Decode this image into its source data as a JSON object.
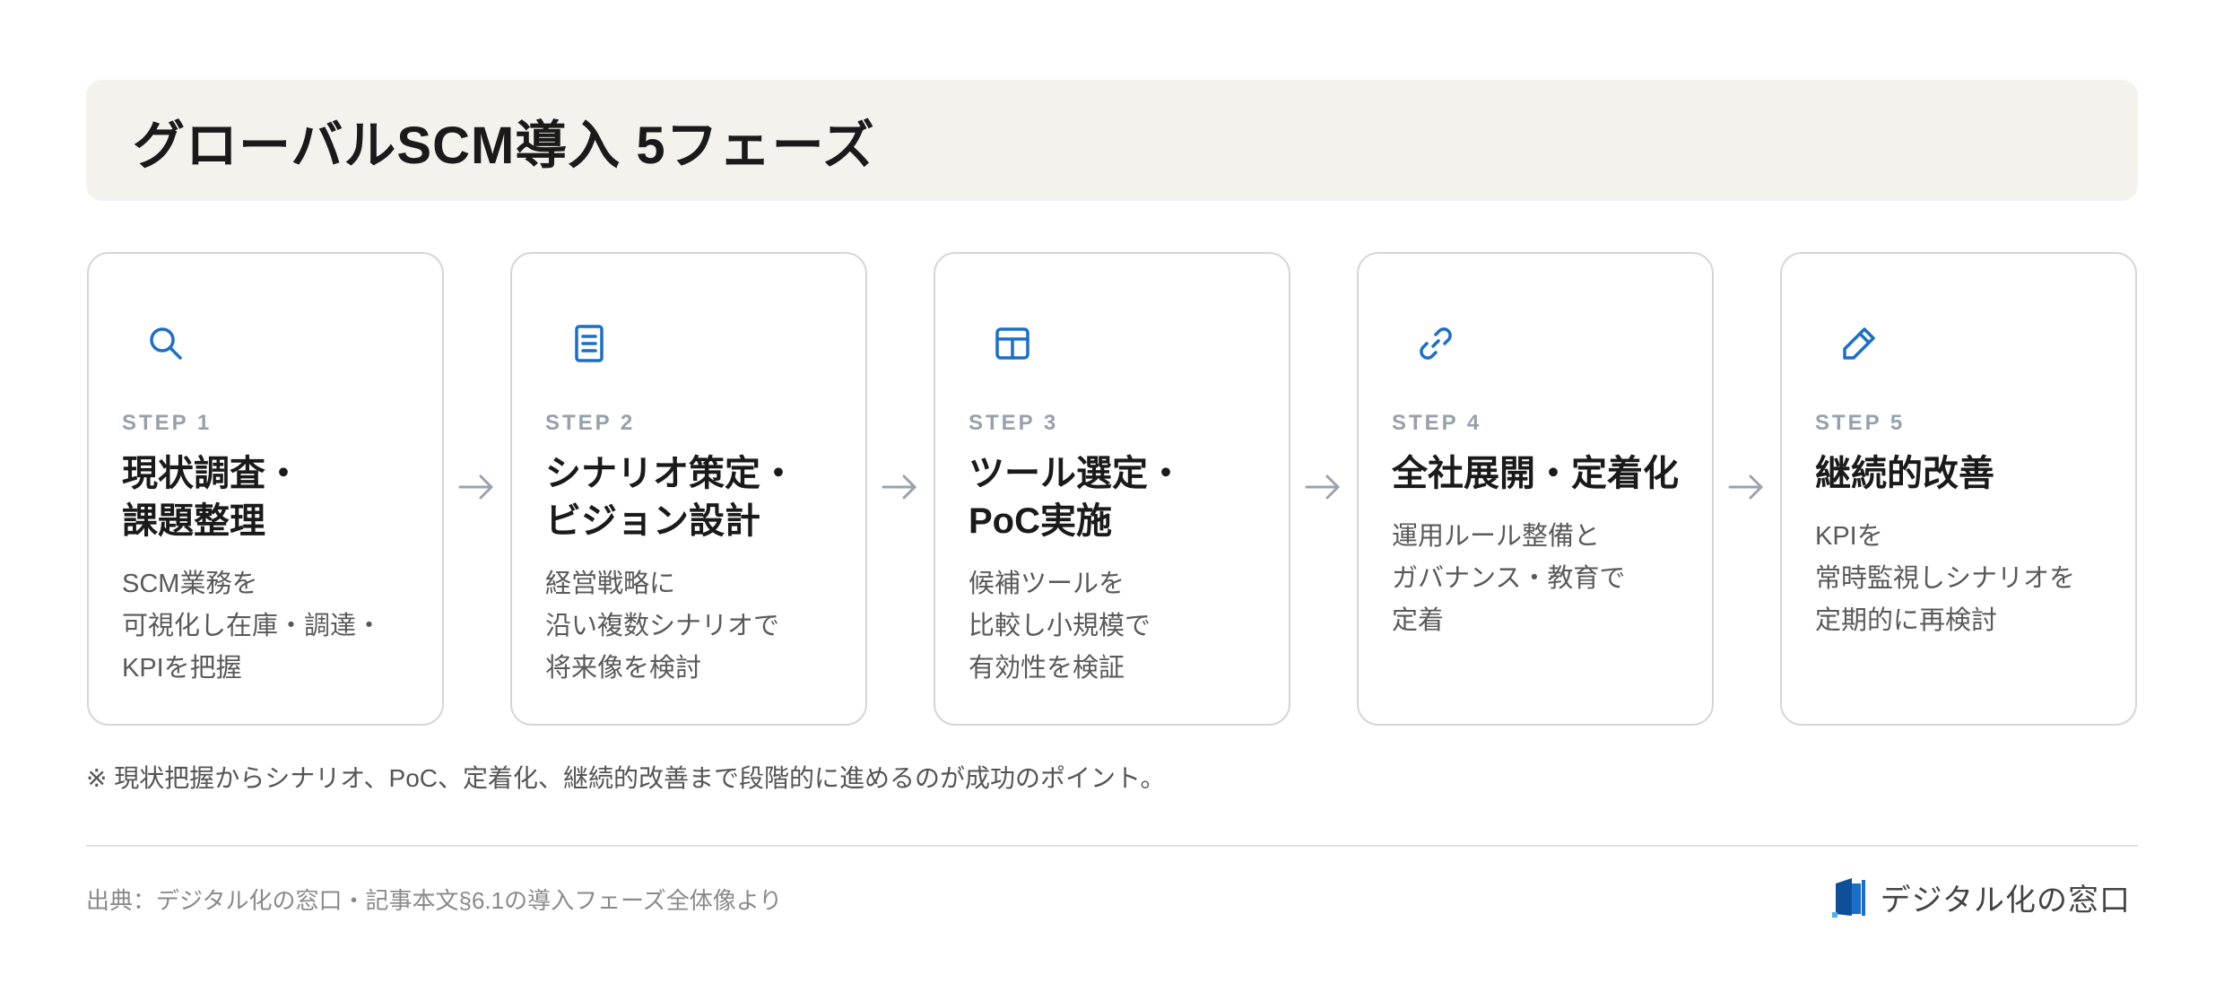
{
  "title": "グローバルSCM導入 5フェーズ",
  "steps": [
    {
      "label": "STEP 1",
      "title": "現状調査・\n課題整理",
      "desc": "SCM業務を\n可視化し在庫・調達・\nKPIを把握",
      "icon": "search-icon"
    },
    {
      "label": "STEP 2",
      "title": "シナリオ策定・\nビジョン設計",
      "desc": "経営戦略に\n沿い複数シナリオで\n将来像を検討",
      "icon": "document-icon"
    },
    {
      "label": "STEP 3",
      "title": "ツール選定・\nPoC実施",
      "desc": "候補ツールを\n比較し小規模で\n有効性を検証",
      "icon": "table-icon"
    },
    {
      "label": "STEP 4",
      "title": "全社展開・定着化",
      "desc": "運用ルール整備と\nガバナンス・教育で\n定着",
      "icon": "link-icon"
    },
    {
      "label": "STEP 5",
      "title": "継続的改善",
      "desc": "KPIを\n常時監視しシナリオを\n定期的に再検討",
      "icon": "pencil-icon"
    }
  ],
  "note": "※ 現状把握からシナリオ、PoC、定着化、継続的改善まで段階的に進めるのが成功のポイント。",
  "source": "出典：デジタル化の窓口・記事本文§6.1の導入フェーズ全体像より",
  "brand": "デジタル化の窓口",
  "colors": {
    "accent": "#1a6fc9",
    "title_bg": "#f4f2ed",
    "step_label": "#97a0ab",
    "arrow": "#9aa3ad"
  }
}
